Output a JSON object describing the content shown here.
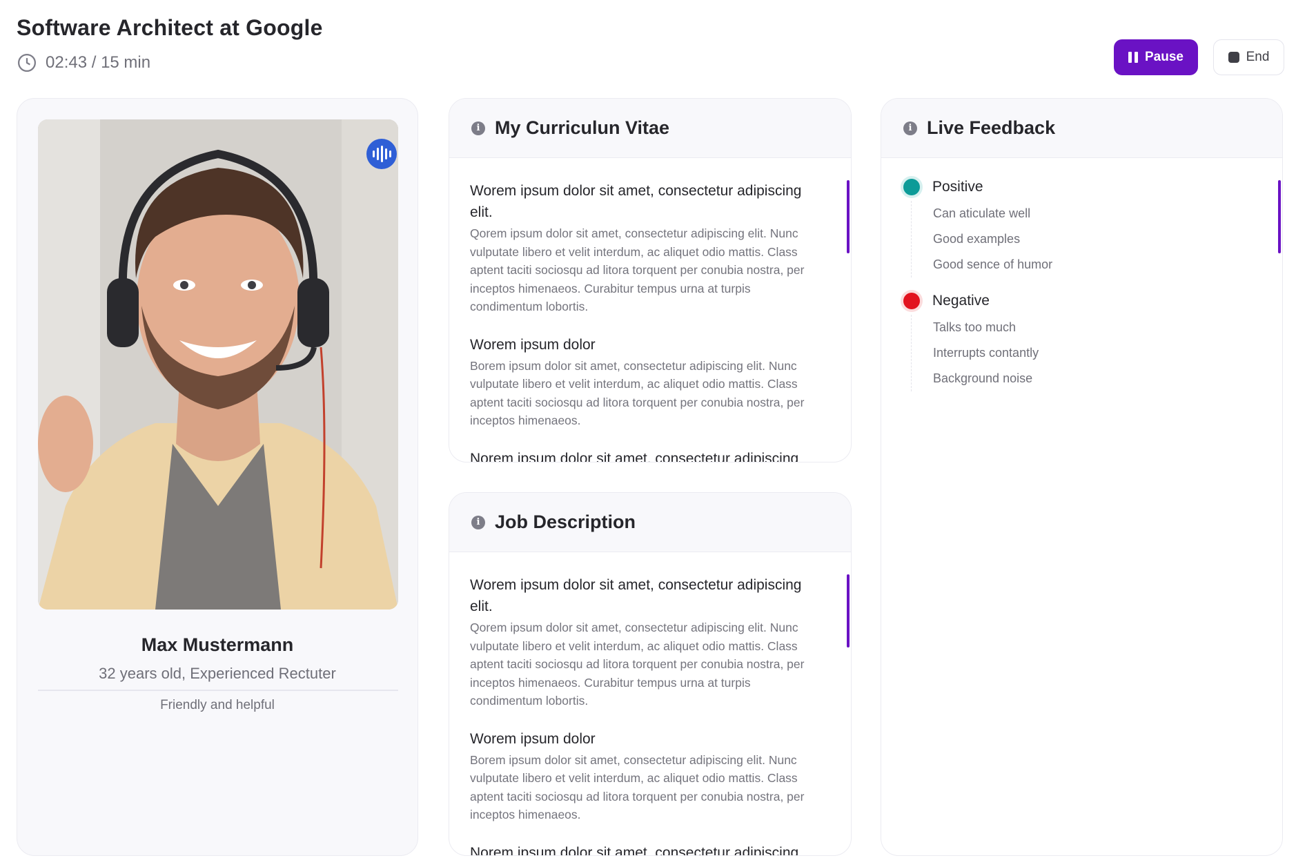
{
  "header": {
    "title": "Software Architect at Google",
    "timer": "02:43 / 15 min",
    "pause_label": "Pause",
    "end_label": "End"
  },
  "profile": {
    "name": "Max Mustermann",
    "subtitle": "32 years old, Experienced Rectuter",
    "persona": "Friendly and helpful",
    "voice_icon": "sound-wave-icon"
  },
  "cv": {
    "title": "My Curriculun Vitae",
    "sections": [
      {
        "heading": "Worem ipsum dolor sit amet, consectetur adipiscing elit.",
        "body": "Qorem ipsum dolor sit amet, consectetur adipiscing elit. Nunc vulputate libero et velit interdum, ac aliquet odio mattis. Class aptent taciti sociosqu ad litora torquent per conubia nostra, per inceptos himenaeos. Curabitur tempus urna at turpis condimentum lobortis."
      },
      {
        "heading": "Worem ipsum dolor",
        "body": "Borem ipsum dolor sit amet, consectetur adipiscing elit. Nunc vulputate libero et velit interdum, ac aliquet odio mattis. Class aptent taciti sociosqu ad litora torquent per conubia nostra, per inceptos himenaeos."
      },
      {
        "heading": "Norem ipsum dolor sit amet, consectetur adipiscing",
        "body": ""
      }
    ]
  },
  "job": {
    "title": "Job Description",
    "sections": [
      {
        "heading": "Worem ipsum dolor sit amet, consectetur adipiscing elit.",
        "body": "Qorem ipsum dolor sit amet, consectetur adipiscing elit. Nunc vulputate libero et velit interdum, ac aliquet odio mattis. Class aptent taciti sociosqu ad litora torquent per conubia nostra, per inceptos himenaeos. Curabitur tempus urna at turpis condimentum lobortis."
      },
      {
        "heading": "Worem ipsum dolor",
        "body": "Borem ipsum dolor sit amet, consectetur adipiscing elit. Nunc vulputate libero et velit interdum, ac aliquet odio mattis. Class aptent taciti sociosqu ad litora torquent per conubia nostra, per inceptos himenaeos."
      },
      {
        "heading": "Norem ipsum dolor sit amet, consectetur adipiscing",
        "body": ""
      }
    ]
  },
  "feedback": {
    "title": "Live Feedback",
    "positive": {
      "label": "Positive",
      "color": "#0c9b98",
      "items": [
        "Can aticulate well",
        "Good examples",
        "Good sence of humor"
      ]
    },
    "negative": {
      "label": "Negative",
      "color": "#e2131f",
      "items": [
        "Talks too much",
        "Interrupts contantly",
        "Background noise"
      ]
    }
  },
  "colors": {
    "accent": "#6a12c4",
    "voice": "#2f5fd6"
  }
}
